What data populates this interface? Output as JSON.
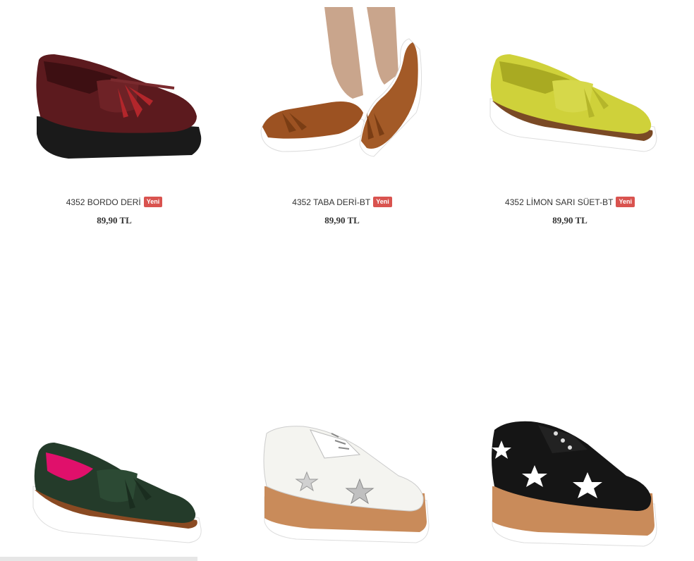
{
  "products": [
    {
      "name": "4352 BORDO DERİ",
      "badge": "Yeni",
      "price": "89,90 TL"
    },
    {
      "name": "4352 TABA DERİ-BT",
      "badge": "Yeni",
      "price": "89,90 TL"
    },
    {
      "name": "4352 LİMON SARI SÜET-BT",
      "badge": "Yeni",
      "price": "89,90 TL"
    },
    {
      "name": "",
      "badge": "",
      "price": ""
    },
    {
      "name": "",
      "badge": "",
      "price": ""
    },
    {
      "name": "",
      "badge": "",
      "price": ""
    }
  ],
  "colors": {
    "badge_bg": "#d9534f",
    "text": "#333333"
  },
  "icons": {
    "p0": "burgundy-tassel-loafer-image",
    "p1": "tan-tassel-loafer-image",
    "p2": "lime-suede-loafer-image",
    "p3": "green-tassel-loafer-image",
    "p4": "white-star-platform-oxford-image",
    "p5": "black-star-platform-oxford-image"
  }
}
